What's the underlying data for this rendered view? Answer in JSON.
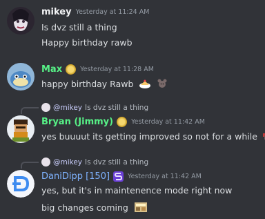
{
  "messages": [
    {
      "username": "mikey",
      "timestamp": "Yesterday at 11:24 AM",
      "lines": [
        "Is dvz still a thing",
        "Happy birthday rawb"
      ],
      "name_color": "#f2f3f5"
    },
    {
      "username": "Max",
      "timestamp": "Yesterday at 11:28 AM",
      "lines": [
        "happy birthday Rawb"
      ],
      "name_color": "#57f287",
      "emojis": [
        "cake-emoji",
        "mouse-emoji"
      ]
    },
    {
      "reply_to": "@mikey",
      "reply_text": "Is dvz still a thing",
      "username": "Bryan (Jimmy)",
      "timestamp": "Yesterday at 11:42 AM",
      "lines": [
        "yes buuuut its getting improved so not for a while"
      ],
      "name_color": "#57f287",
      "emojis": [
        "pixel-mouse-emoji"
      ]
    },
    {
      "reply_to": "@mikey",
      "reply_text": "Is dvz still a thing",
      "username": "DaniDipp [150]",
      "timestamp": "Yesterday at 11:42 AM",
      "lines": [
        "yes, but it's in maintenence mode right now",
        "big changes coming"
      ],
      "name_color": "#7fb3ff",
      "emojis": [
        "construction-emoji"
      ]
    }
  ],
  "colors": {
    "background": "#313338",
    "timestamp": "#949ba4",
    "text": "#dbdee1"
  }
}
